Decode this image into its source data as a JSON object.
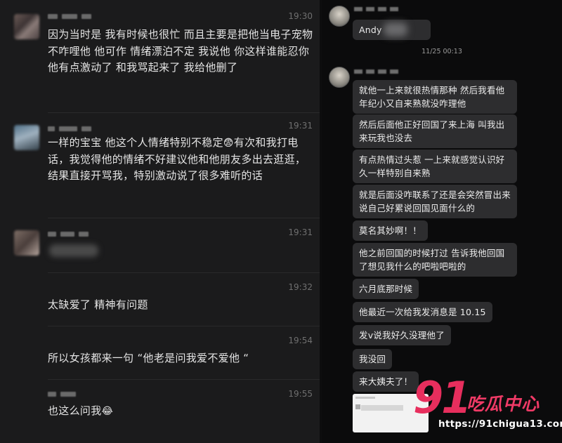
{
  "left_chat": {
    "messages": [
      {
        "time": "19:30",
        "text": "因为当时是 我有时候也很忙 而且主要是把他当电子宠物 不咋哩他 他可作 情绪漂泊不定 我说他 你这样谁能忍你 他有点激动了 和我骂起来了 我给他删了"
      },
      {
        "time": "19:31",
        "text_before": "一样的宝宝 他这个人情绪特别不稳定",
        "emoji": "😨",
        "text_after": "有次和我打电话，我觉得他的情绪不好建议他和他朋友多出去逛逛，结果直接开骂我，特别激动说了很多难听的话"
      },
      {
        "time": "19:31"
      },
      {
        "time": "19:32",
        "text": "太缺爱了 精神有问题"
      },
      {
        "time": "19:54",
        "text": "所以女孩都来一句 “他老是问我爱不爱他 “"
      },
      {
        "time": "19:55",
        "text": "也这么问我",
        "emoji": "😂"
      }
    ]
  },
  "right_chat": {
    "first_bubble": "Andy",
    "date_divider": "11/25 00:13",
    "bubbles": [
      "就他一上来就很热情那种 然后我看他年纪小又自来熟就没咋理他",
      "然后后面他正好回国了来上海 叫我出来玩我也没去",
      "有点热情过头惹 一上来就感觉认识好久一样特别自来熟",
      "就是后面没咋联系了还是会突然冒出来说自己好累说回国见面什么的",
      "莫名其妙啊！！",
      "他之前回国的时候打过 告诉我他回国了想见我什么的吧啦吧啦的",
      "六月底那时候",
      "他最近一次给我发消息是 10.15",
      "发v说我好久没理他了",
      "我没回",
      "来大姨夫了！"
    ]
  },
  "watermark": {
    "number": "91",
    "cn": "吃瓜中心",
    "url": "https://91chigua13.com",
    "color": "#e72e5d"
  }
}
